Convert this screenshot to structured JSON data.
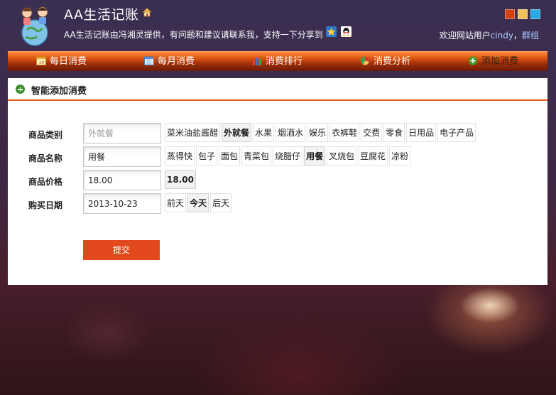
{
  "header": {
    "title": "AA生活记账",
    "tagline": "AA生活记账由冯湘灵提供，有问题和建议请联系我，支持一下分享到",
    "share_icons": [
      "qzone-icon",
      "qq-icon"
    ],
    "theme_swatches": [
      "#d2420f",
      "#f2c15a",
      "#2ba8e3"
    ],
    "welcome_prefix": "欢迎网站用户",
    "username": "cindy",
    "group_link": "群组"
  },
  "nav": {
    "items": [
      {
        "label": "每日消费",
        "icon": "calendar-day-icon"
      },
      {
        "label": "每月消费",
        "icon": "calendar-month-icon"
      },
      {
        "label": "消费排行",
        "icon": "bar-chart-icon"
      },
      {
        "label": "消费分析",
        "icon": "pie-chart-icon"
      },
      {
        "label": "添加消费",
        "icon": "plus-circle-icon"
      }
    ],
    "active_index": 4
  },
  "panel": {
    "title": "智能添加消费",
    "form": {
      "category": {
        "label": "商品类别",
        "placeholder": "外就餐",
        "options": [
          "菜米油盐酱醋",
          "外就餐",
          "水果",
          "烟酒水",
          "娱乐",
          "衣裤鞋",
          "交费",
          "零食",
          "日用品",
          "电子产品"
        ],
        "selected": "外就餐"
      },
      "name": {
        "label": "商品名称",
        "value": "用餐",
        "options": [
          "蒸得快",
          "包子",
          "面包",
          "青菜包",
          "烧腊仔",
          "用餐",
          "叉烧包",
          "豆腐花",
          "凉粉"
        ],
        "selected": "用餐"
      },
      "price": {
        "label": "商品价格",
        "value": "18.00",
        "options": [
          "18.00"
        ],
        "selected": "18.00"
      },
      "date": {
        "label": "购买日期",
        "value": "2013-10-23",
        "options": [
          "前天",
          "今天",
          "后天"
        ],
        "selected": "今天"
      },
      "submit_label": "提交"
    }
  }
}
